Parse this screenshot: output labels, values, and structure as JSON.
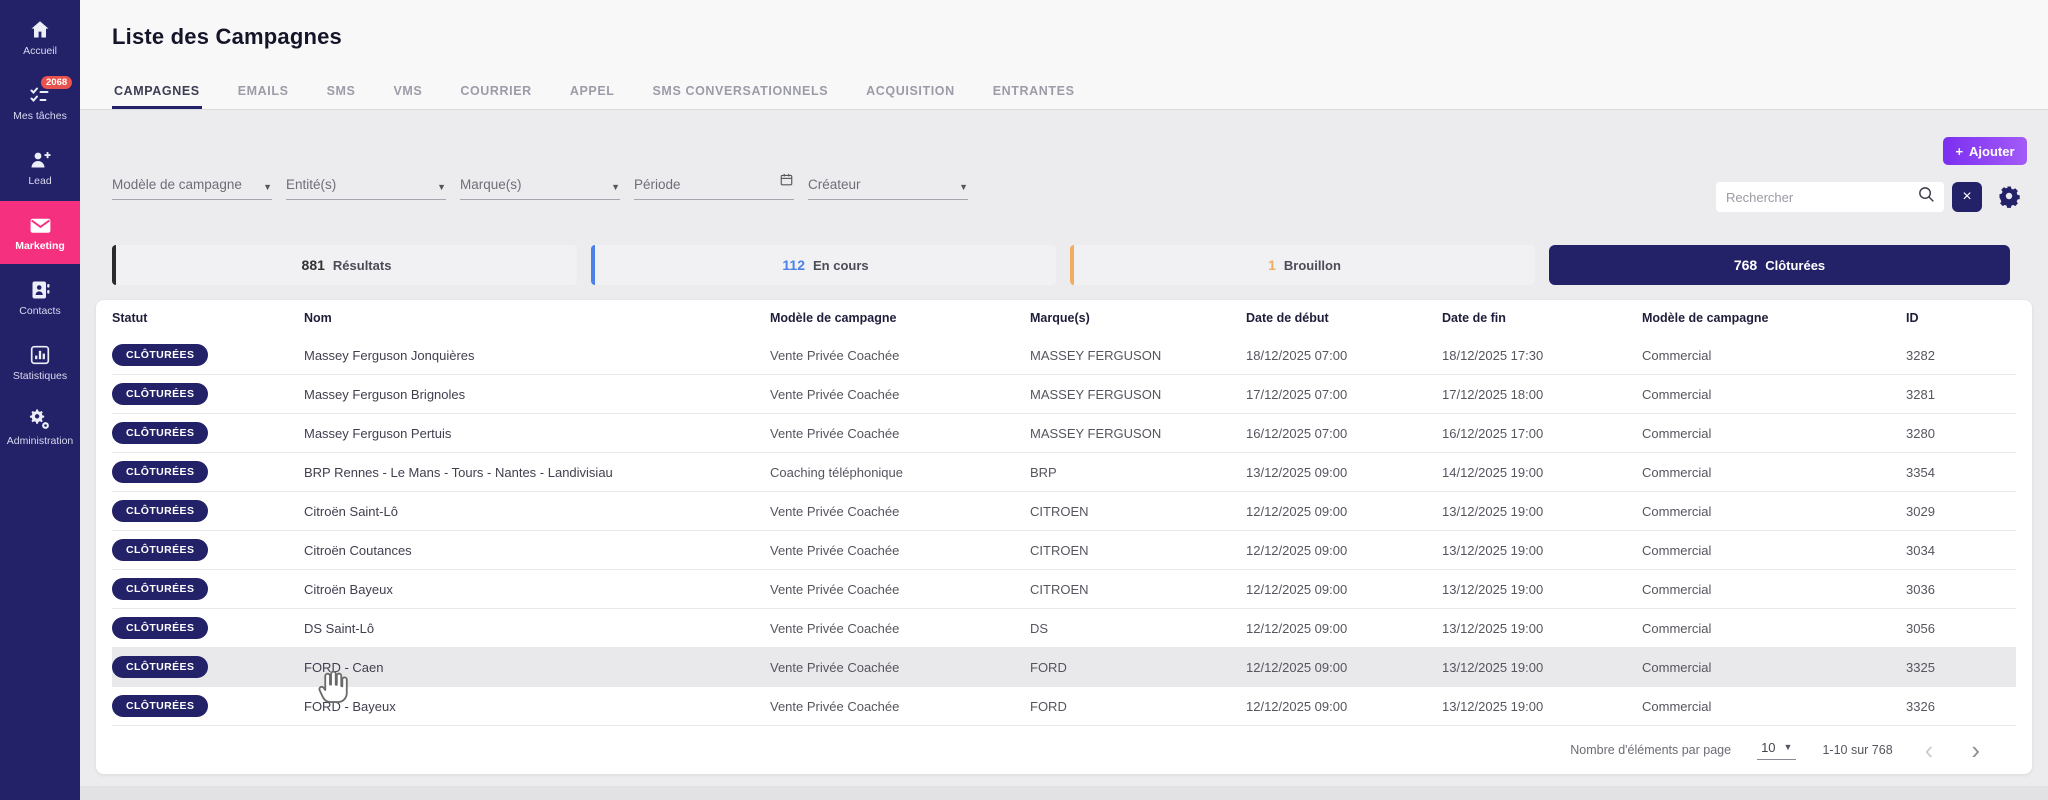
{
  "sidebar": {
    "items": [
      {
        "label": "Accueil",
        "icon": "home-icon",
        "active": false
      },
      {
        "label": "Mes tâches",
        "icon": "tasks-icon",
        "badge": "2068",
        "active": false
      },
      {
        "label": "Lead",
        "icon": "person-add-icon",
        "active": false
      },
      {
        "label": "Marketing",
        "icon": "envelope-icon",
        "active": true
      },
      {
        "label": "Contacts",
        "icon": "contacts-icon",
        "active": false
      },
      {
        "label": "Statistiques",
        "icon": "bar-chart-icon",
        "active": false
      },
      {
        "label": "Administration",
        "icon": "gears-icon",
        "active": false
      }
    ]
  },
  "header": {
    "title": "Liste des Campagnes"
  },
  "tabs": [
    {
      "label": "CAMPAGNES",
      "active": true,
      "data_name": "tab-campagnes"
    },
    {
      "label": "EMAILS",
      "active": false,
      "data_name": "tab-emails"
    },
    {
      "label": "SMS",
      "active": false,
      "data_name": "tab-sms"
    },
    {
      "label": "VMS",
      "active": false,
      "data_name": "tab-vms"
    },
    {
      "label": "COURRIER",
      "active": false,
      "data_name": "tab-courrier"
    },
    {
      "label": "APPEL",
      "active": false,
      "data_name": "tab-appel"
    },
    {
      "label": "SMS CONVERSATIONNELS",
      "active": false,
      "data_name": "tab-sms-conversationnels"
    },
    {
      "label": "ACQUISITION",
      "active": false,
      "data_name": "tab-acquisition"
    },
    {
      "label": "ENTRANTES",
      "active": false,
      "data_name": "tab-entrantes"
    }
  ],
  "toolbar": {
    "add_label": "Ajouter"
  },
  "filters": [
    {
      "label": "Modèle de campagne",
      "icon": "chevron-down-icon"
    },
    {
      "label": "Entité(s)",
      "icon": "chevron-down-icon"
    },
    {
      "label": "Marque(s)",
      "icon": "chevron-down-icon"
    },
    {
      "label": "Période",
      "icon": "calendar-icon"
    },
    {
      "label": "Créateur",
      "icon": "chevron-down-icon"
    }
  ],
  "search": {
    "placeholder": "Rechercher"
  },
  "stats": [
    {
      "value": "881",
      "label": "Résultats",
      "accent": "#2b2b2b",
      "selected": false
    },
    {
      "value": "112",
      "label": "En cours",
      "accent": "#4b81e8",
      "selected": false
    },
    {
      "value": "1",
      "label": "Brouillon",
      "accent": "#f0ad61",
      "selected": false
    },
    {
      "value": "768",
      "label": "Clôturées",
      "accent": "#232168",
      "selected": true
    }
  ],
  "table": {
    "columns": [
      "Statut",
      "Nom",
      "Modèle de campagne",
      "Marque(s)",
      "Date de début",
      "Date de fin",
      "Modèle de campagne",
      "ID"
    ],
    "rows": [
      {
        "statut": "CLÔTURÉES",
        "nom": "Massey Ferguson Jonquières",
        "modele": "Vente Privée Coachée",
        "marque": "MASSEY FERGUSON",
        "debut": "18/12/2025 07:00",
        "fin": "18/12/2025 17:30",
        "modele2": "Commercial",
        "id": "3282",
        "highlight": false
      },
      {
        "statut": "CLÔTURÉES",
        "nom": "Massey Ferguson Brignoles",
        "modele": "Vente Privée Coachée",
        "marque": "MASSEY FERGUSON",
        "debut": "17/12/2025 07:00",
        "fin": "17/12/2025 18:00",
        "modele2": "Commercial",
        "id": "3281",
        "highlight": false
      },
      {
        "statut": "CLÔTURÉES",
        "nom": "Massey Ferguson Pertuis",
        "modele": "Vente Privée Coachée",
        "marque": "MASSEY FERGUSON",
        "debut": "16/12/2025 07:00",
        "fin": "16/12/2025 17:00",
        "modele2": "Commercial",
        "id": "3280",
        "highlight": false
      },
      {
        "statut": "CLÔTURÉES",
        "nom": "BRP Rennes - Le Mans - Tours - Nantes - Landivisiau",
        "modele": "Coaching téléphonique",
        "marque": "BRP",
        "debut": "13/12/2025 09:00",
        "fin": "14/12/2025 19:00",
        "modele2": "Commercial",
        "id": "3354",
        "highlight": false
      },
      {
        "statut": "CLÔTURÉES",
        "nom": "Citroën Saint-Lô",
        "modele": "Vente Privée Coachée",
        "marque": "CITROEN",
        "debut": "12/12/2025 09:00",
        "fin": "13/12/2025 19:00",
        "modele2": "Commercial",
        "id": "3029",
        "highlight": false
      },
      {
        "statut": "CLÔTURÉES",
        "nom": "Citroën Coutances",
        "modele": "Vente Privée Coachée",
        "marque": "CITROEN",
        "debut": "12/12/2025 09:00",
        "fin": "13/12/2025 19:00",
        "modele2": "Commercial",
        "id": "3034",
        "highlight": false
      },
      {
        "statut": "CLÔTURÉES",
        "nom": "Citroën Bayeux",
        "modele": "Vente Privée Coachée",
        "marque": "CITROEN",
        "debut": "12/12/2025 09:00",
        "fin": "13/12/2025 19:00",
        "modele2": "Commercial",
        "id": "3036",
        "highlight": false
      },
      {
        "statut": "CLÔTURÉES",
        "nom": "DS Saint-Lô",
        "modele": "Vente Privée Coachée",
        "marque": "DS",
        "debut": "12/12/2025 09:00",
        "fin": "13/12/2025 19:00",
        "modele2": "Commercial",
        "id": "3056",
        "highlight": false
      },
      {
        "statut": "CLÔTURÉES",
        "nom": "FORD - Caen",
        "modele": "Vente Privée Coachée",
        "marque": "FORD",
        "debut": "12/12/2025 09:00",
        "fin": "13/12/2025 19:00",
        "modele2": "Commercial",
        "id": "3325",
        "highlight": true
      },
      {
        "statut": "CLÔTURÉES",
        "nom": "FORD - Bayeux",
        "modele": "Vente Privée Coachée",
        "marque": "FORD",
        "debut": "12/12/2025 09:00",
        "fin": "13/12/2025 19:00",
        "modele2": "Commercial",
        "id": "3326",
        "highlight": false
      }
    ]
  },
  "pagination": {
    "label": "Nombre d'éléments par page",
    "page_size": "10",
    "range": "1-10 sur 768"
  },
  "icons": {
    "chevron_down": "▼",
    "clear": "×",
    "prev": "‹",
    "next": "›",
    "add_plus": "+"
  },
  "colors": {
    "sidebar": "#232168",
    "active_pink": "#f5317f",
    "add_button": "#8b3df2",
    "badge_navy": "#232168",
    "stat_blue": "#4b81e8",
    "stat_orange": "#f0ad61",
    "task_badge_red": "#e9534e"
  }
}
